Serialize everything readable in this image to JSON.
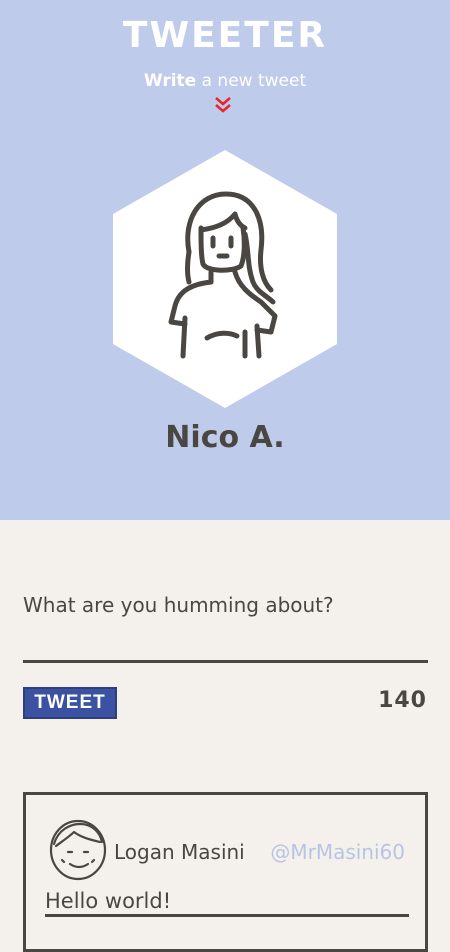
{
  "app": {
    "title": "TWEETER"
  },
  "header": {
    "subtitle_bold": "Write",
    "subtitle_rest": " a new tweet",
    "chevron_icon": "double-chevron-down-icon",
    "chevron_color": "#e8262b"
  },
  "profile": {
    "name": "Nico A.",
    "avatar_icon": "woman-avatar-icon"
  },
  "composer": {
    "placeholder": "What are you humming about?",
    "tweet_button": "TWEET",
    "char_count": "140"
  },
  "feed": {
    "tweets": [
      {
        "author": "Logan Masini",
        "handle": "@MrMasini60",
        "text": "Hello world!",
        "avatar_icon": "man-avatar-icon"
      }
    ]
  },
  "colors": {
    "hero_bg": "#bfcbea",
    "page_bg": "#f4f1ec",
    "button_bg": "#3b51a2",
    "text": "#4a4742",
    "handle": "#b9c4e3"
  }
}
